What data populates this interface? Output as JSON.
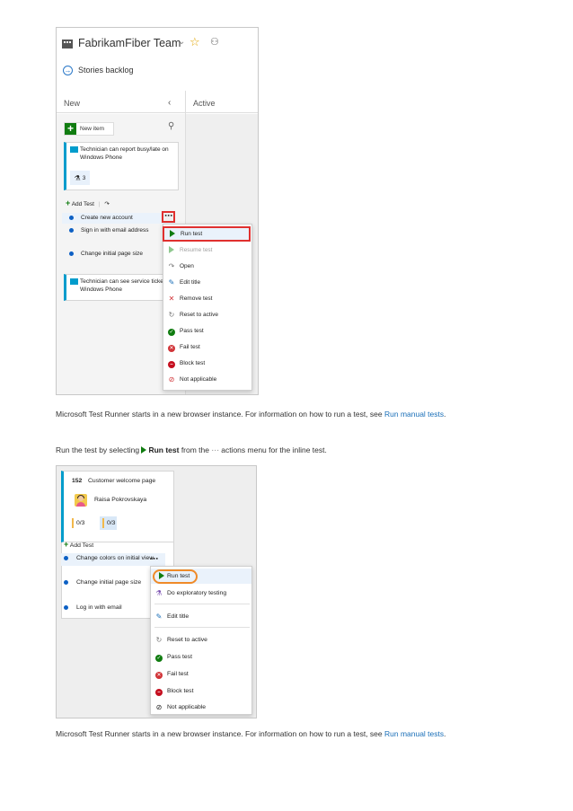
{
  "screenshot1": {
    "team_name": "FabrikamFiber Team",
    "backlog_link": "Stories backlog",
    "column_new": "New",
    "column_active": "Active",
    "new_item_label": "New item",
    "card1": {
      "title": "Technician can report busy/late on Windows Phone",
      "task_count": "3"
    },
    "add_test_label": "Add Test",
    "tests": [
      "Create new account",
      "Sign in with email address",
      "Change initial page size"
    ],
    "card2": {
      "title": "Technician can see service tickets on Windows Phone"
    },
    "menu_items": [
      {
        "label": "Run test",
        "icon": "play-icon",
        "state": "highlighted"
      },
      {
        "label": "Resume test",
        "icon": "resume-icon",
        "state": "disabled"
      },
      {
        "label": "Open",
        "icon": "open-arrow-icon",
        "state": "normal"
      },
      {
        "label": "Edit title",
        "icon": "pencil-icon",
        "state": "normal"
      },
      {
        "label": "Remove test",
        "icon": "x-icon",
        "state": "normal"
      },
      {
        "label": "Reset to active",
        "icon": "reset-icon",
        "state": "normal"
      },
      {
        "label": "Pass test",
        "icon": "check-circle-icon",
        "state": "normal"
      },
      {
        "label": "Fail test",
        "icon": "fail-circle-icon",
        "state": "normal"
      },
      {
        "label": "Block test",
        "icon": "block-circle-icon",
        "state": "normal"
      },
      {
        "label": "Not applicable",
        "icon": "na-circle-icon",
        "state": "normal"
      }
    ]
  },
  "paragraph1": {
    "text": "Microsoft Test Runner starts in a new browser instance. For information on how to run a test, see ",
    "link": "Run manual tests",
    "end": "."
  },
  "paragraph2": {
    "before": "Run the test by selecting ",
    "bold": "Run test",
    "middle": " from the ",
    "ellipsis": "⋯",
    "after": " actions menu for the inline test."
  },
  "screenshot2": {
    "card_id": "152",
    "card_title": "Customer welcome page",
    "assignee": "Raisa Pokrovskaya",
    "chip1": "0/3",
    "chip2": "0/3",
    "add_test_label": "Add Test",
    "tests": [
      "Change colors on initial view",
      "Change initial page size",
      "Log in with email"
    ],
    "menu_items": [
      {
        "label": "Run test",
        "icon": "play-icon"
      },
      {
        "label": "Do exploratory testing",
        "icon": "flask-icon"
      },
      {
        "label": "Edit title",
        "icon": "pencil-icon"
      },
      {
        "label": "Reset to active",
        "icon": "reset-icon"
      },
      {
        "label": "Pass test",
        "icon": "check-circle-icon"
      },
      {
        "label": "Fail test",
        "icon": "fail-circle-icon"
      },
      {
        "label": "Block test",
        "icon": "block-circle-icon"
      },
      {
        "label": "Not applicable",
        "icon": "na-circle-icon"
      }
    ]
  },
  "paragraph3": {
    "text": "Microsoft Test Runner starts in a new browser instance. For information on how to run a test, see ",
    "link": "Run manual tests",
    "end": "."
  },
  "colors": {
    "accent_blue": "#009ccc",
    "link": "#1a6fb8",
    "highlight_red": "#e0302f",
    "highlight_orange": "#ef8a28",
    "green": "#107c10"
  }
}
